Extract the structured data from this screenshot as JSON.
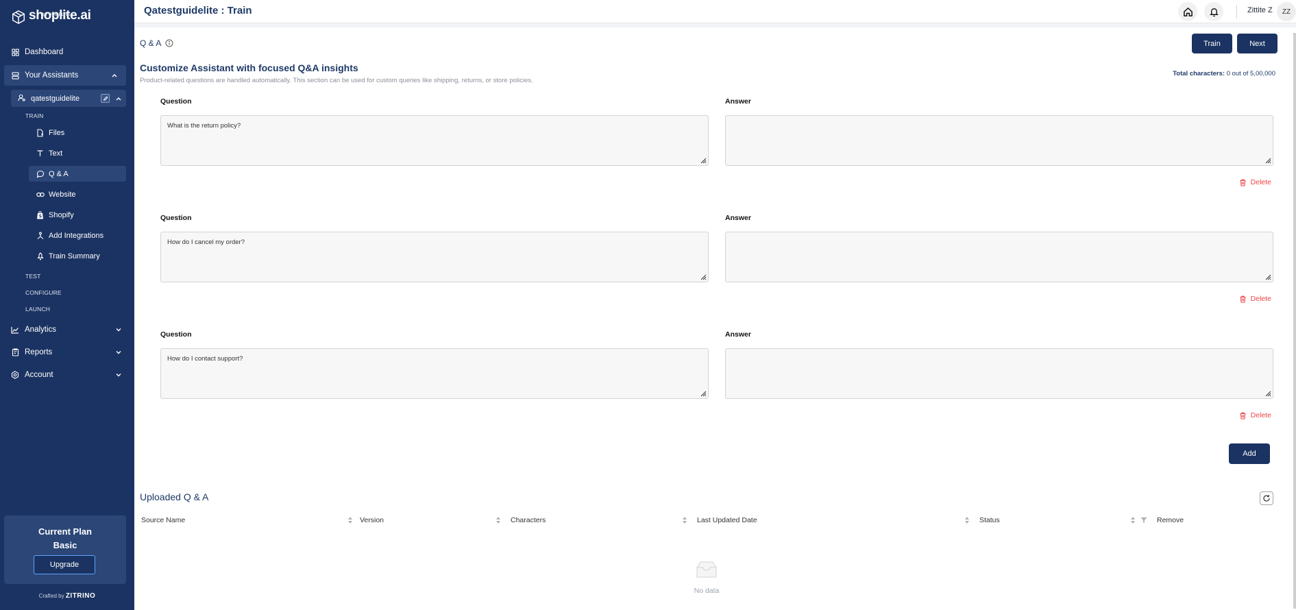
{
  "brand": {
    "logo_text": "shoplite.ai",
    "logo_sub": "by GUIDELITE",
    "logo_icon": "cube-logo-icon"
  },
  "sidebar": {
    "dashboard": "Dashboard",
    "your_assistants": "Your Assistants",
    "assistant_name": "qatestguidelite",
    "train_label": "TRAIN",
    "train_items": [
      "Files",
      "Text",
      "Q & A",
      "Website",
      "Shopify",
      "Add Integrations",
      "Train Summary"
    ],
    "test_label": "TEST",
    "configure_label": "CONFIGURE",
    "launch_label": "LAUNCH",
    "analytics": "Analytics",
    "reports": "Reports",
    "account": "Account",
    "plan_title": "Current Plan",
    "plan_name": "Basic",
    "upgrade_label": "Upgrade",
    "crafted_by": "Crafted by",
    "crafted_brand": "ZITRINO"
  },
  "header": {
    "title": "Qatestguidelite : Train",
    "user_name": "Zittite Z",
    "avatar_initials": "ZZ",
    "icons": [
      "home-icon",
      "bell-icon"
    ]
  },
  "main": {
    "qa_label": "Q & A",
    "train_button": "Train",
    "next_button": "Next",
    "heading": "Customize Assistant with focused Q&A insights",
    "description": "Product-related questions are handled automatically. This section can be used for custom queries like shipping, returns, or store policies.",
    "total_chars_label": "Total characters:",
    "total_chars_value": "0 out of 5,00,000",
    "question_label": "Question",
    "answer_label": "Answer",
    "delete_label": "Delete",
    "add_button": "Add",
    "qa_pairs": [
      {
        "question": "What is the return policy?",
        "answer": ""
      },
      {
        "question": "How do I cancel my order?",
        "answer": ""
      },
      {
        "question": "How do I contact support?",
        "answer": ""
      }
    ],
    "uploaded_title": "Uploaded Q & A",
    "table_columns": [
      "Source Name",
      "Version",
      "Characters",
      "Last Updated Date",
      "Status",
      "Remove"
    ],
    "empty_text": "No data"
  },
  "colors": {
    "sidebar_bg": "#1b3362",
    "sidebar_active": "#2b4677",
    "accent_dark": "#1b3362",
    "delete_red": "#ef4444",
    "title_blue": "#1f3a68"
  }
}
